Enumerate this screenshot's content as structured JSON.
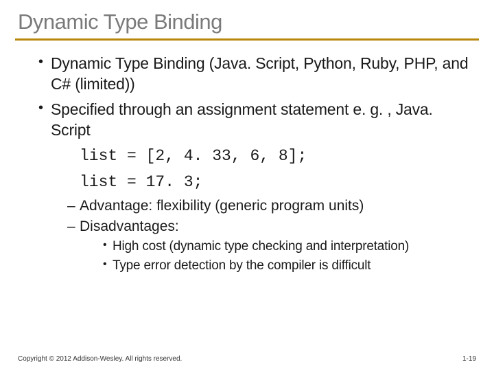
{
  "title": "Dynamic Type Binding",
  "bullets": {
    "b1": "Dynamic Type Binding (Java. Script, Python, Ruby, PHP, and C# (limited))",
    "b2": "Specified through an assignment statement e. g. , Java. Script"
  },
  "code": {
    "line1": "list = [2, 4. 33, 6, 8];",
    "line2": "list = 17. 3;"
  },
  "sub": {
    "adv": "Advantage: flexibility (generic program units)",
    "disadv": "Disadvantages:"
  },
  "subsub": {
    "d1": "High cost (dynamic type checking and interpretation)",
    "d2": "Type error detection by the compiler is difficult"
  },
  "footer": {
    "copyright": "Copyright © 2012 Addison-Wesley. All rights reserved.",
    "pagenum": "1-19"
  }
}
